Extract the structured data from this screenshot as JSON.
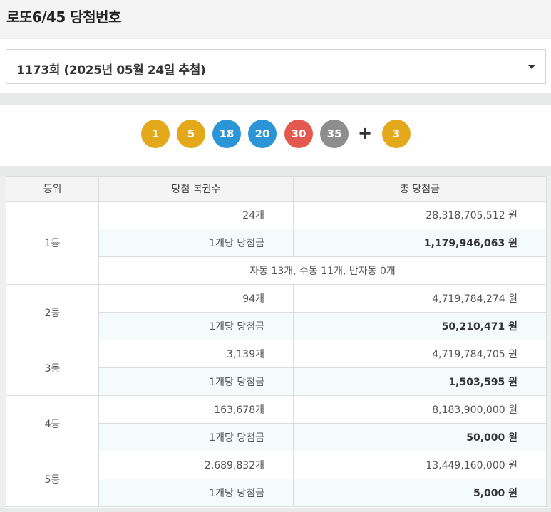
{
  "header": {
    "title": "로또6/45 당첨번호"
  },
  "round_select": {
    "selected": "1173회 (2025년 05월 24일 추첨)"
  },
  "balls": {
    "numbers": [
      {
        "value": "1",
        "color": "#e3a91a"
      },
      {
        "value": "5",
        "color": "#e3a91a"
      },
      {
        "value": "18",
        "color": "#2c95d6"
      },
      {
        "value": "20",
        "color": "#2c95d6"
      },
      {
        "value": "30",
        "color": "#e3594f"
      },
      {
        "value": "35",
        "color": "#8e8e8e"
      }
    ],
    "plus": "+",
    "bonus": {
      "value": "3",
      "color": "#e3a91a"
    }
  },
  "table": {
    "headers": [
      "등위",
      "당첨 복권수",
      "총 당첨금"
    ],
    "per_label": "1개당 당첨금",
    "rows": [
      {
        "rank": "1등",
        "count": "24개",
        "total": "28,318,705,512 원",
        "per": "1,179,946,063 원",
        "note": "자동 13개, 수동 11개, 반자동 0개"
      },
      {
        "rank": "2등",
        "count": "94개",
        "total": "4,719,784,274 원",
        "per": "50,210,471 원"
      },
      {
        "rank": "3등",
        "count": "3,139개",
        "total": "4,719,784,705 원",
        "per": "1,503,595 원"
      },
      {
        "rank": "4등",
        "count": "163,678개",
        "total": "8,183,900,000 원",
        "per": "50,000 원"
      },
      {
        "rank": "5등",
        "count": "2,689,832개",
        "total": "13,449,160,000 원",
        "per": "5,000 원"
      }
    ]
  }
}
